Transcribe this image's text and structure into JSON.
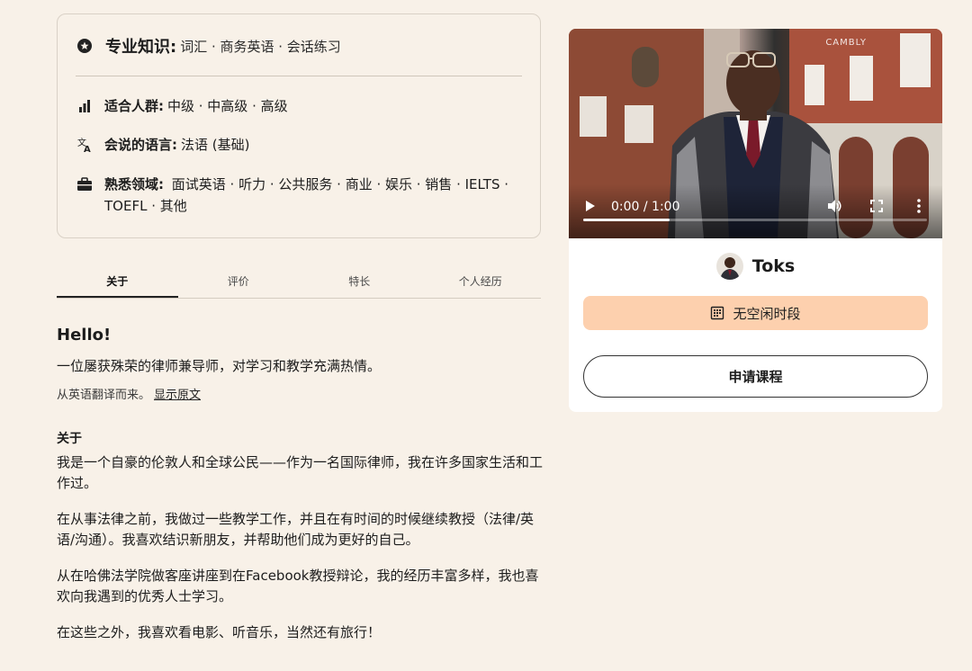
{
  "expertise": {
    "specialty": {
      "label": "专业知识:",
      "value": "词汇 · 商务英语 · 会话练习",
      "icon": "badge-icon"
    },
    "audience": {
      "label": "适合人群:",
      "value": "中级 · 中高级 · 高级",
      "icon": "bar-chart-icon"
    },
    "languages": {
      "label": "会说的语言:",
      "value": "法语 (基础)",
      "icon": "translate-icon"
    },
    "domains": {
      "label": "熟悉领域:",
      "value": "面试英语 · 听力 · 公共服务 · 商业 · 娱乐 · 销售 · IELTS · TOEFL · 其他",
      "icon": "briefcase-icon"
    }
  },
  "tabs": [
    {
      "label": "关于",
      "active": true
    },
    {
      "label": "评价",
      "active": false
    },
    {
      "label": "特长",
      "active": false
    },
    {
      "label": "个人经历",
      "active": false
    }
  ],
  "about": {
    "greeting": "Hello!",
    "intro": "一位屡获殊荣的律师兼导师，对学习和教学充满热情。",
    "translated_note": "从英语翻译而来。",
    "show_original": "显示原文",
    "section_title": "关于",
    "paragraphs": [
      "我是一个自豪的伦敦人和全球公民——作为一名国际律师，我在许多国家生活和工作过。",
      "在从事法律之前，我做过一些教学工作，并且在有时间的时候继续教授（法律/英语/沟通）。我喜欢结识新朋友，并帮助他们成为更好的自己。",
      "从在哈佛法学院做客座讲座到在Facebook教授辩论，我的经历丰富多样，我也喜欢向我遇到的优秀人士学习。",
      "在这些之外，我喜欢看电影、听音乐，当然还有旅行！"
    ]
  },
  "video": {
    "watermark": "CAMBLY",
    "time": "0:00 / 1:00",
    "progress": 0.25
  },
  "tutor": {
    "name": "Toks",
    "no_slots_label": "无空闲时段",
    "request_label": "申请课程"
  },
  "colors": {
    "background": "#f8f1e8",
    "slot_button": "#fdd0ae",
    "card": "#ffffff"
  }
}
